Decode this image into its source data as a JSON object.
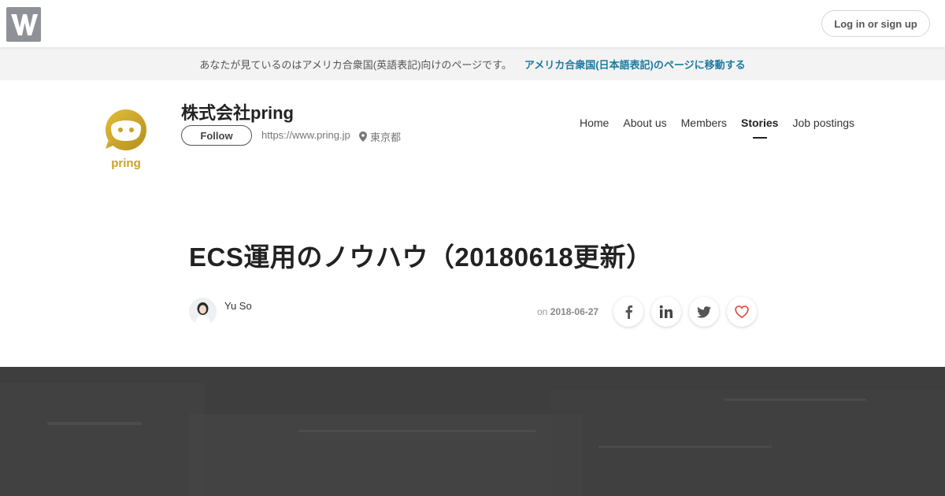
{
  "header": {
    "logo_icon": "wantedly-w-icon",
    "login_label": "Log in or sign up"
  },
  "locale_notice": {
    "message": "あなたが見ているのはアメリカ合衆国(英語表記)向けのページです。",
    "link": "アメリカ合衆国(日本語表記)のページに移動する"
  },
  "company": {
    "name": "株式会社pring",
    "follow_label": "Follow",
    "url": "https://www.pring.jp",
    "location": "東京都",
    "logo_text": "pring",
    "logo_color": "#c9a227"
  },
  "nav": {
    "items": [
      {
        "label": "Home"
      },
      {
        "label": "About us"
      },
      {
        "label": "Members"
      },
      {
        "label": "Stories"
      },
      {
        "label": "Job postings"
      }
    ],
    "active": "Stories"
  },
  "story": {
    "title": "ECS運用のノウハウ（20180618更新）",
    "author": "Yu So",
    "date_prefix": "on",
    "date": "2018-06-27"
  },
  "share": {
    "icons": [
      "facebook-icon",
      "linkedin-icon",
      "twitter-icon",
      "heart-icon"
    ],
    "heart_color": "#e0483e"
  }
}
